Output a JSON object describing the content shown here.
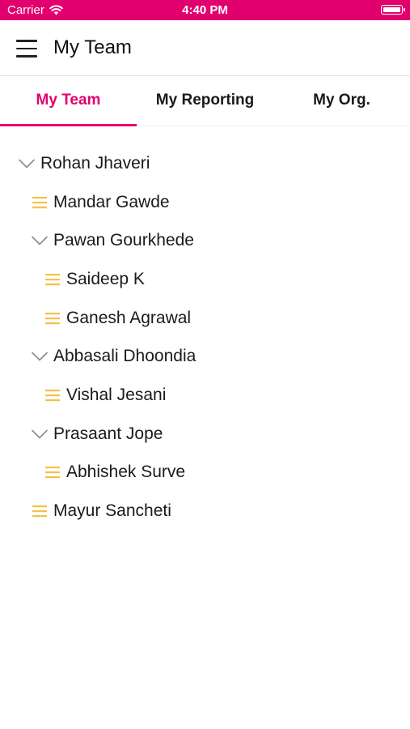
{
  "status_bar": {
    "carrier": "Carrier",
    "time": "4:40 PM"
  },
  "header": {
    "title": "My Team"
  },
  "tabs": [
    {
      "label": "My Team",
      "active": true
    },
    {
      "label": "My Reporting",
      "active": false
    },
    {
      "label": "My Org.",
      "active": false
    }
  ],
  "colors": {
    "accent": "#e2006e",
    "leaf_icon": "#f5c04a",
    "chevron": "#8a8a8a"
  },
  "tree": [
    {
      "name": "Rohan Jhaveri",
      "level": 0,
      "icon": "chevron-down-icon"
    },
    {
      "name": "Mandar Gawde",
      "level": 1,
      "icon": "list-lines-icon"
    },
    {
      "name": "Pawan Gourkhede",
      "level": 1,
      "icon": "chevron-down-icon"
    },
    {
      "name": "Saideep K",
      "level": 2,
      "icon": "list-lines-icon"
    },
    {
      "name": "Ganesh Agrawal",
      "level": 2,
      "icon": "list-lines-icon"
    },
    {
      "name": "Abbasali Dhoondia",
      "level": 1,
      "icon": "chevron-down-icon"
    },
    {
      "name": "Vishal Jesani",
      "level": 2,
      "icon": "list-lines-icon"
    },
    {
      "name": "Prasaant Jope",
      "level": 1,
      "icon": "chevron-down-icon"
    },
    {
      "name": "Abhishek Surve",
      "level": 2,
      "icon": "list-lines-icon"
    },
    {
      "name": "Mayur Sancheti",
      "level": 1,
      "icon": "list-lines-icon"
    }
  ]
}
